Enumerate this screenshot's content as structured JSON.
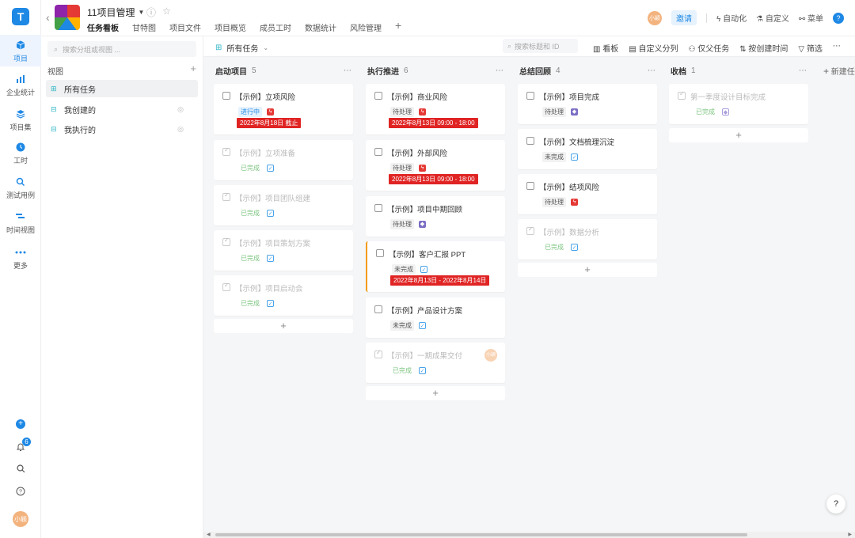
{
  "rail": {
    "logo": "T",
    "items": [
      {
        "label": "项目",
        "icon": "cube-icon",
        "active": true
      },
      {
        "label": "企业统计",
        "icon": "chart-icon"
      },
      {
        "label": "项目集",
        "icon": "layers-icon"
      },
      {
        "label": "工时",
        "icon": "clock-icon"
      },
      {
        "label": "测试用例",
        "icon": "test-icon"
      },
      {
        "label": "时间视图",
        "icon": "timeline-icon"
      },
      {
        "label": "更多",
        "icon": "more-icon"
      }
    ],
    "notifications": "6",
    "user_avatar": "小颖"
  },
  "header": {
    "project_title": "11项目管理",
    "tabs": [
      "任务看板",
      "甘特图",
      "项目文件",
      "项目概览",
      "成员工时",
      "数据统计",
      "风险管理"
    ],
    "right": {
      "avatar": "小颖",
      "invite": "邀请",
      "automation": "自动化",
      "customize": "自定义",
      "menu": "菜单",
      "help": "?"
    }
  },
  "views": {
    "search_placeholder": "搜索分组或视图 ...",
    "heading": "视图",
    "items": [
      "所有任务",
      "我创建的",
      "我执行的"
    ]
  },
  "toolbar": {
    "current_view": "所有任务",
    "search_placeholder": "搜索标题和 ID",
    "items": [
      "看板",
      "自定义分列",
      "仅父任务",
      "按创建时间",
      "筛选"
    ],
    "new_column": "新建任"
  },
  "columns": [
    {
      "name": "启动项目",
      "count": "5",
      "cards": [
        {
          "title": "【示例】立项风险",
          "status": "进行中",
          "priority": "red",
          "due": "2022年8月18日 截止"
        },
        {
          "title": "【示例】立项准备",
          "status": "已完成",
          "done": true
        },
        {
          "title": "【示例】项目团队组建",
          "status": "已完成",
          "done": true
        },
        {
          "title": "【示例】项目策划方案",
          "status": "已完成",
          "done": true
        },
        {
          "title": "【示例】项目启动会",
          "status": "已完成",
          "done": true
        }
      ]
    },
    {
      "name": "执行推进",
      "count": "6",
      "cards": [
        {
          "title": "【示例】商业风险",
          "status": "待处理",
          "priority": "red",
          "due": "2022年8月13日 09:00 - 18:00"
        },
        {
          "title": "【示例】外部风险",
          "status": "待处理",
          "priority": "red",
          "due": "2022年8月13日 09:00 - 18:00"
        },
        {
          "title": "【示例】项目中期回顾",
          "status": "待处理",
          "priority": "purple"
        },
        {
          "title": "【示例】客户汇报 PPT",
          "status": "未完成",
          "priority": "lblue",
          "due": "2022年8月13日 - 2022年8月14日"
        },
        {
          "title": "【示例】产品设计方案",
          "status": "未完成",
          "priority": "lblue"
        },
        {
          "title": "【示例】一期成果交付",
          "status": "已完成",
          "done": true,
          "avatar": "小颖"
        }
      ]
    },
    {
      "name": "总结回顾",
      "count": "4",
      "cards": [
        {
          "title": "【示例】项目完成",
          "status": "待处理",
          "priority": "purple"
        },
        {
          "title": "【示例】文档梳理沉淀",
          "status": "未完成",
          "priority": "lblue"
        },
        {
          "title": "【示例】结项风险",
          "status": "待处理",
          "priority": "red"
        },
        {
          "title": "【示例】数据分析",
          "status": "已完成",
          "done": true
        }
      ]
    },
    {
      "name": "收档",
      "count": "1",
      "cards": [
        {
          "title": "第一季度设计目标完成",
          "status": "已完成",
          "done": true,
          "priority": "lpurple"
        }
      ]
    }
  ]
}
